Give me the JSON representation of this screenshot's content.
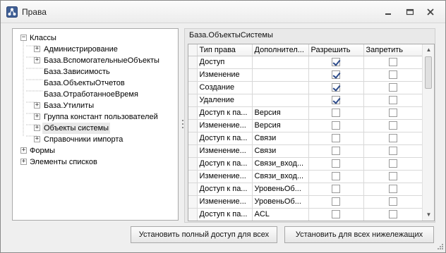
{
  "window": {
    "title": "Права"
  },
  "tree": {
    "nodes": [
      {
        "label": "Классы",
        "expander": "−"
      },
      {
        "label": "Администрирование",
        "expander": "+"
      },
      {
        "label": "База.ВспомогательныеОбъекты",
        "expander": "+"
      },
      {
        "label": "База.Зависимость",
        "expander": ""
      },
      {
        "label": "База.ОбъектыОтчетов",
        "expander": ""
      },
      {
        "label": "База.ОтработанноеВремя",
        "expander": ""
      },
      {
        "label": "База.Утилиты",
        "expander": "+"
      },
      {
        "label": "Группа констант пользователей",
        "expander": "+"
      },
      {
        "label": "Объекты системы",
        "expander": "+",
        "selected": true
      },
      {
        "label": "Справочники импорта",
        "expander": "+"
      },
      {
        "label": "Формы",
        "expander": "+"
      },
      {
        "label": "Элементы списков",
        "expander": "+"
      }
    ]
  },
  "panel": {
    "title": "База.ОбъектыСистемы"
  },
  "grid": {
    "columns": [
      "Тип права",
      "Дополнител...",
      "Разрешить",
      "Запретить"
    ],
    "rows": [
      {
        "type": "Доступ",
        "extra": "",
        "allow": true,
        "deny": false
      },
      {
        "type": "Изменение",
        "extra": "",
        "allow": true,
        "deny": false
      },
      {
        "type": "Создание",
        "extra": "",
        "allow": true,
        "deny": false
      },
      {
        "type": "Удаление",
        "extra": "",
        "allow": true,
        "deny": false
      },
      {
        "type": "Доступ к па...",
        "extra": "Версия",
        "allow": false,
        "deny": false
      },
      {
        "type": "Изменение...",
        "extra": "Версия",
        "allow": false,
        "deny": false
      },
      {
        "type": "Доступ к па...",
        "extra": "Связи",
        "allow": false,
        "deny": false
      },
      {
        "type": "Изменение...",
        "extra": "Связи",
        "allow": false,
        "deny": false
      },
      {
        "type": "Доступ к па...",
        "extra": "Связи_вход...",
        "allow": false,
        "deny": false
      },
      {
        "type": "Изменение...",
        "extra": "Связи_вход...",
        "allow": false,
        "deny": false
      },
      {
        "type": "Доступ к па...",
        "extra": "УровеньОб...",
        "allow": false,
        "deny": false
      },
      {
        "type": "Изменение...",
        "extra": "УровеньОб...",
        "allow": false,
        "deny": false
      },
      {
        "type": "Доступ к па...",
        "extra": "ACL",
        "allow": false,
        "deny": false
      }
    ]
  },
  "buttons": {
    "full_access": "Установить полный доступ для всех",
    "all_below": "Установить для всех нижележащих"
  },
  "icons": {
    "app": "network-icon",
    "minimize": "minimize-icon",
    "maximize": "maximize-icon",
    "close": "close-icon"
  }
}
